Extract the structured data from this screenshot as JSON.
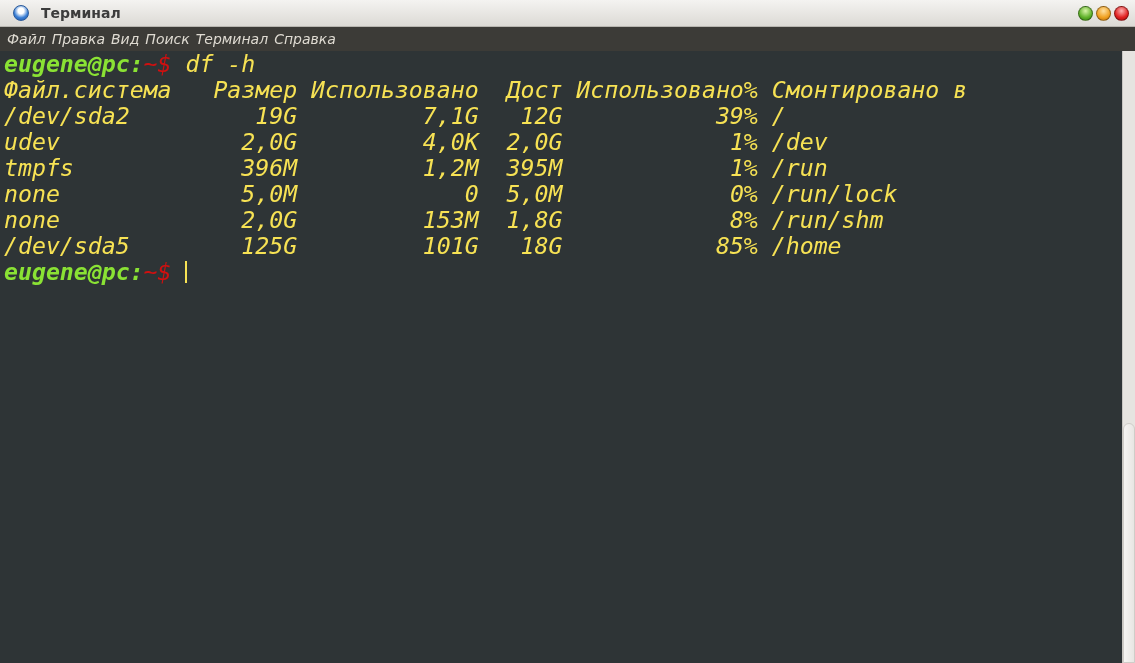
{
  "window": {
    "title": "Терминал"
  },
  "menu": [
    "Файл",
    "Правка",
    "Вид",
    "Поиск",
    "Терминал",
    "Справка"
  ],
  "terminal": {
    "command_prompt": {
      "user_host": "eugene@pc:",
      "path": "~$",
      "command": "df -h"
    },
    "table": {
      "columns": [
        "Файл.система",
        "Размер",
        "Использовано",
        "Дост",
        "Использовано%",
        "Смонтировано в"
      ],
      "rows": [
        [
          "/dev/sda2",
          "19G",
          "7,1G",
          "12G",
          "39%",
          "/"
        ],
        [
          "udev",
          "2,0G",
          "4,0K",
          "2,0G",
          "1%",
          "/dev"
        ],
        [
          "tmpfs",
          "396M",
          "1,2M",
          "395M",
          "1%",
          "/run"
        ],
        [
          "none",
          "5,0M",
          "0",
          "5,0M",
          "0%",
          "/run/lock"
        ],
        [
          "none",
          "2,0G",
          "153M",
          "1,8G",
          "8%",
          "/run/shm"
        ],
        [
          "/dev/sda5",
          "125G",
          "101G",
          "18G",
          "85%",
          "/home"
        ]
      ]
    },
    "current_prompt": {
      "user_host": "eugene@pc:",
      "path": "~$",
      "cursor": true
    }
  }
}
